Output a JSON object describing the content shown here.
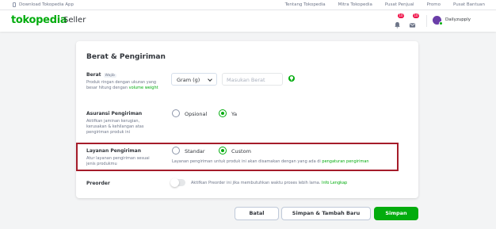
{
  "topbar": {
    "download_label": "Download Tokopedia App",
    "links": [
      "Tentang Tokopedia",
      "Mitra Tokopedia",
      "Pusat Penjual",
      "Promo",
      "Pusat Bantuan"
    ]
  },
  "header": {
    "logo": "tokopedia",
    "logo_suffix": "Seller",
    "notif_badge": "10",
    "mail_badge": "10",
    "shop_name": "Dailyzupply"
  },
  "section": {
    "title": "Berat & Pengiriman",
    "weight": {
      "label": "Berat",
      "tag": "Wajib",
      "desc": "Produk ringan dengan ukuran yang besar hitung dengan",
      "desc_link": "volume weight",
      "unit_selected": "Gram (g)",
      "input_placeholder": "Masukan Berat",
      "tip_icon": "lightbulb-icon"
    },
    "insurance": {
      "label": "Asuransi Pengiriman",
      "desc": "Aktifkan jaminan kerugian, kerusakan & kehilangan atas pengiriman produk ini",
      "options": [
        "Opsional",
        "Ya"
      ],
      "selected": "Ya"
    },
    "shipping": {
      "label": "Layanan Pengiriman",
      "desc": "Atur layanan pengiriman sesuai jenis produkmu",
      "options": [
        "Standar",
        "Custom"
      ],
      "selected": "Custom",
      "note": "Layanan pengiriman untuk produk ini akan disamakan dengan yang ada di",
      "note_link": "pengaturan pengiriman"
    },
    "preorder": {
      "label": "Preorder",
      "enabled": false,
      "text": "Aktifkan Preorder ini jika membutuhkan waktu proses lebih lama.",
      "link": "Info Lengkap"
    }
  },
  "actions": {
    "cancel": "Batal",
    "save_add": "Simpan & Tambah Baru",
    "save": "Simpan"
  },
  "colors": {
    "brand": "#03ac0e",
    "highlight_border": "#a51c2a",
    "badge": "#ef144a"
  }
}
